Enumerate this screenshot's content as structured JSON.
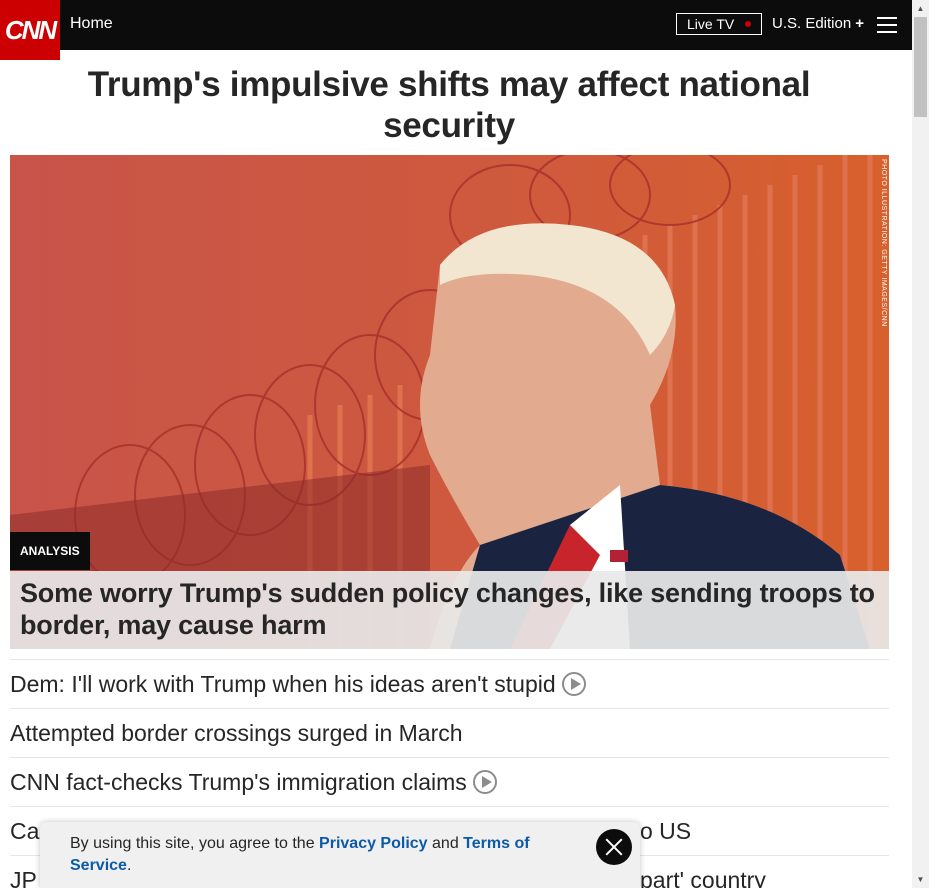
{
  "nav": {
    "logo": "CNN",
    "home": "Home",
    "live_tv": "Live TV",
    "edition": "U.S. Edition",
    "edition_plus": "+"
  },
  "headline": "Trump's impulsive shifts may affect national security",
  "hero": {
    "credit": "PHOTO ILLUSTRATION: GETTY IMAGES/CNN",
    "badge": "ANALYSIS",
    "caption": "Some worry Trump's sudden policy changes, like sending troops to border, may cause harm"
  },
  "stories": [
    {
      "text": "Dem: I'll work with Trump when his ideas aren't stupid",
      "video": true
    },
    {
      "text": "Attempted border crossings surged in March",
      "video": false
    },
    {
      "text": "CNN fact-checks Trump's immigration claims",
      "video": true
    },
    {
      "text": "Ca",
      "tail": "o US",
      "video": false
    },
    {
      "text": "JP",
      "tail": "part' country",
      "video": false
    }
  ],
  "cookie": {
    "prefix": "By using this site, you agree to the",
    "privacy": "Privacy Policy",
    "and": "and",
    "terms": "Terms of Service",
    "suffix": "."
  },
  "colors": {
    "brand": "#cc0000",
    "link": "#0c5aa6",
    "nav_bg": "#0c0c0c"
  }
}
